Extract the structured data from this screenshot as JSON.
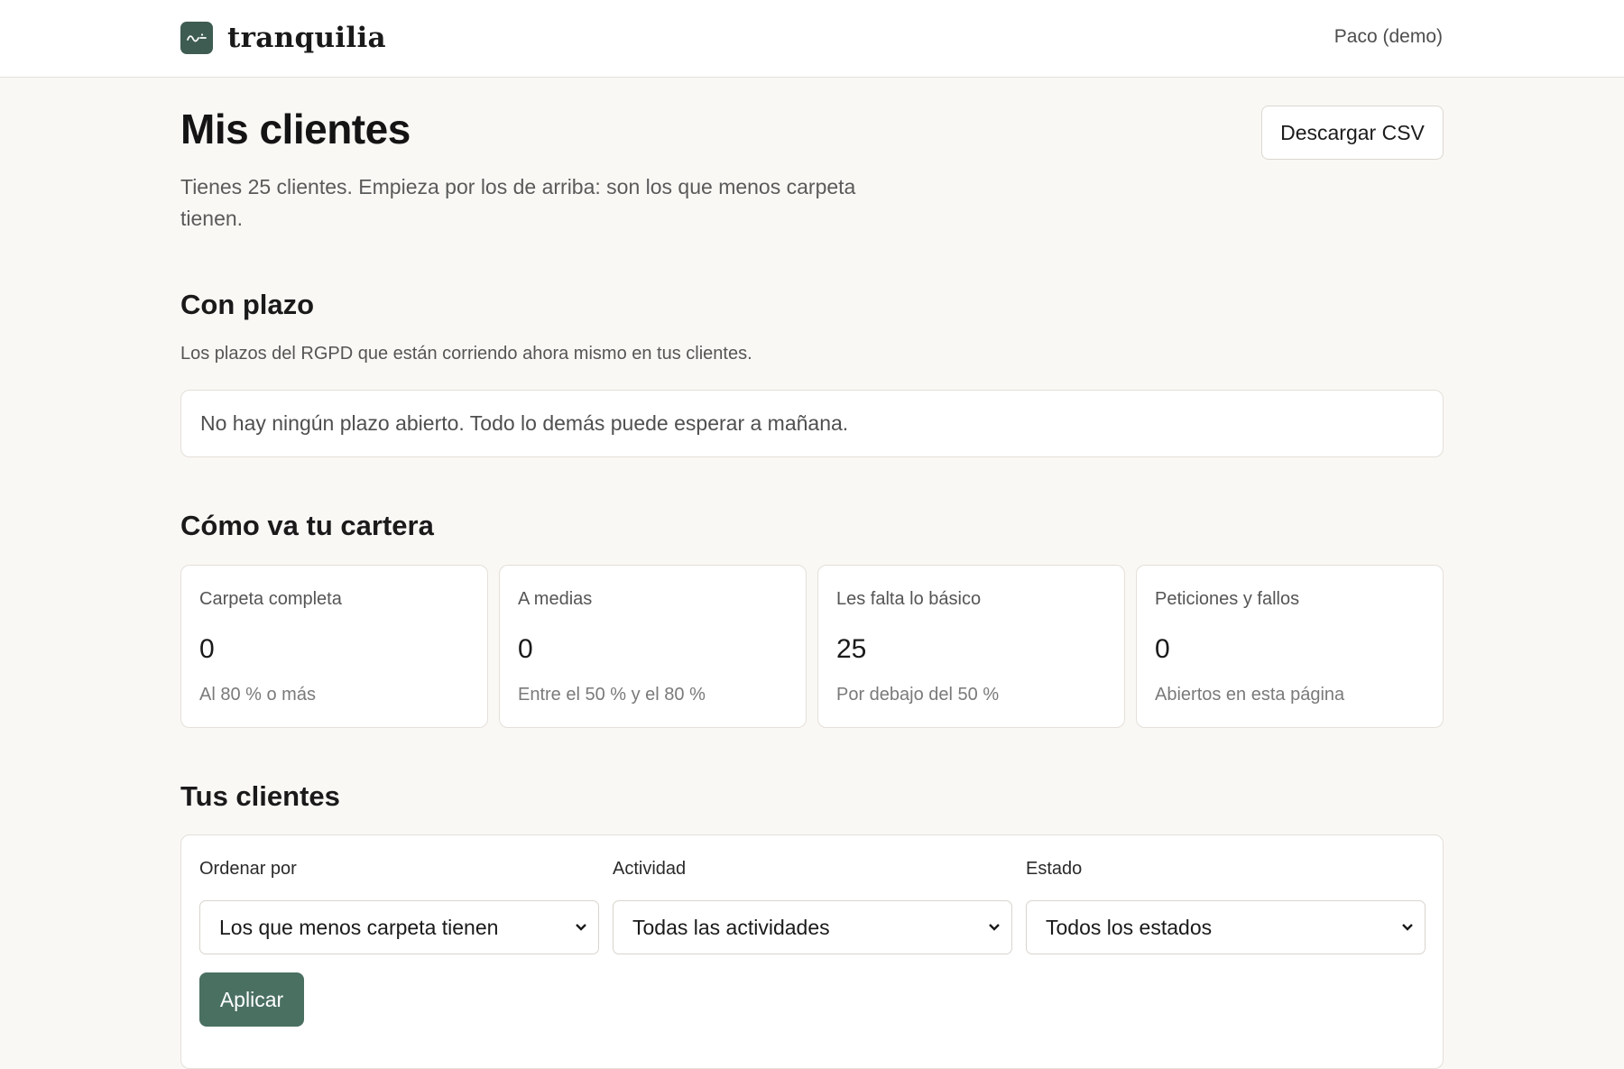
{
  "header": {
    "brand": "tranquilia",
    "user": "Paco (demo)"
  },
  "page": {
    "title": "Mis clientes",
    "csv_button": "Descargar CSV",
    "subtitle": "Tienes 25 clientes. Empieza por los de arriba: son los que menos carpeta tienen."
  },
  "plazo": {
    "heading": "Con plazo",
    "description": "Los plazos del RGPD que están corriendo ahora mismo en tus clientes.",
    "empty_message": "No hay ningún plazo abierto. Todo lo demás puede esperar a mañana."
  },
  "cartera": {
    "heading": "Cómo va tu cartera",
    "stats": [
      {
        "label": "Carpeta completa",
        "value": "0",
        "note": "Al 80 % o más"
      },
      {
        "label": "A medias",
        "value": "0",
        "note": "Entre el 50 % y el 80 %"
      },
      {
        "label": "Les falta lo básico",
        "value": "25",
        "note": "Por debajo del 50 %"
      },
      {
        "label": "Peticiones y fallos",
        "value": "0",
        "note": "Abiertos en esta página"
      }
    ]
  },
  "clientes": {
    "heading": "Tus clientes",
    "filters": {
      "sort": {
        "label": "Ordenar por",
        "value": "Los que menos carpeta tienen"
      },
      "activity": {
        "label": "Actividad",
        "value": "Todas las actividades"
      },
      "status": {
        "label": "Estado",
        "value": "Todos los estados"
      }
    },
    "apply_button": "Aplicar"
  },
  "icons": {
    "logo": "wave-logo-icon",
    "select_arrow": "chevron-down-icon"
  },
  "colors": {
    "brand": "#3e5c52",
    "primary_button": "#4a7062",
    "background": "#faf8f5"
  }
}
